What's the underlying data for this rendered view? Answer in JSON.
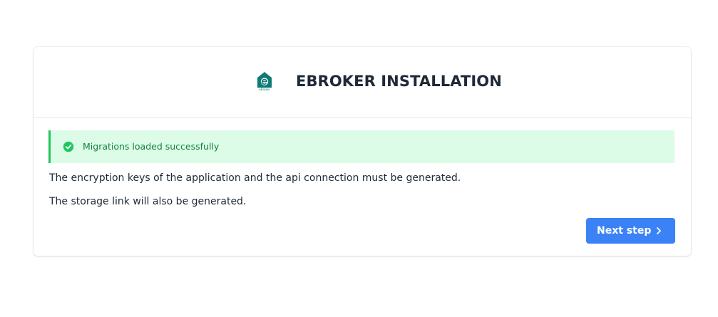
{
  "header": {
    "logo_alt": "eBroker",
    "logo_small_text": "eBroker",
    "title": "EBROKER INSTALLATION"
  },
  "alert": {
    "message": "Migrations loaded successfully",
    "icon": "check-circle-icon"
  },
  "content": {
    "paragraph_1": "The encryption keys of the application and the api connection must be generated.",
    "paragraph_2": "The storage link will also be generated."
  },
  "actions": {
    "next_label": "Next step",
    "next_icon": "chevron-right-icon"
  },
  "colors": {
    "brand_teal": "#0e7a76",
    "success_bg": "#dcfce7",
    "success_border": "#22c55e",
    "success_text": "#15803d",
    "primary_button": "#3b82f6"
  }
}
